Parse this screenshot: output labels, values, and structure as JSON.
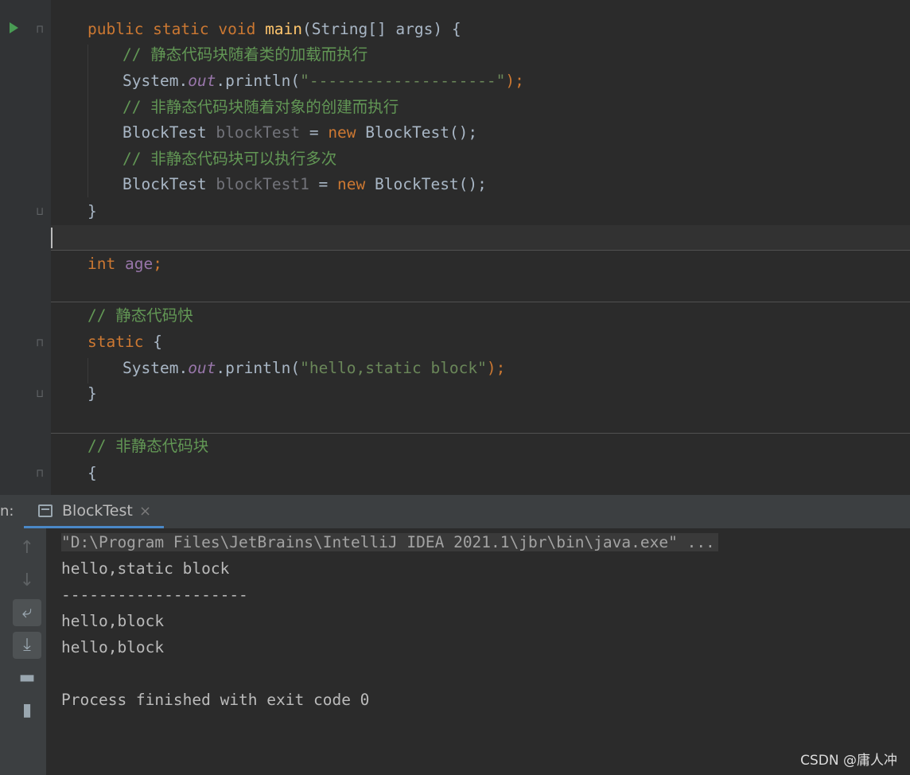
{
  "editor": {
    "lines": [
      [
        "public static void ",
        "main",
        "(String[] args) {"
      ],
      "// 静态代码块随着类的加载而执行",
      [
        "System.",
        "out",
        ".println(",
        "\"--------------------\"",
        ");"
      ],
      "// 非静态代码块随着对象的创建而执行",
      [
        "BlockTest ",
        "blockTest",
        " = ",
        "new ",
        "BlockTest();"
      ],
      "// 非静态代码块可以执行多次",
      [
        "BlockTest ",
        "blockTest1",
        " = ",
        "new ",
        "BlockTest();"
      ],
      "}",
      [
        "int ",
        "age",
        ";"
      ],
      "// 静态代码快",
      [
        "static ",
        "{"
      ],
      [
        "System.",
        "out",
        ".println(",
        "\"hello,static block\"",
        ");"
      ],
      "}",
      "// 非静态代码块",
      "{"
    ]
  },
  "run_panel": {
    "prefix": "n:",
    "tab_label": "BlockTest",
    "tab_close": "×"
  },
  "console": {
    "command": "\"D:\\Program Files\\JetBrains\\IntelliJ IDEA 2021.1\\jbr\\bin\\java.exe\" ...",
    "output": [
      "hello,static block",
      "--------------------",
      "hello,block",
      "hello,block",
      "",
      "Process finished with exit code 0"
    ]
  },
  "toolbar": {
    "icons": [
      "arrow-up-icon",
      "arrow-down-icon",
      "soft-wrap-icon",
      "scroll-to-end-icon",
      "print-icon",
      "trash-icon"
    ]
  },
  "watermark": "CSDN @庸人冲"
}
